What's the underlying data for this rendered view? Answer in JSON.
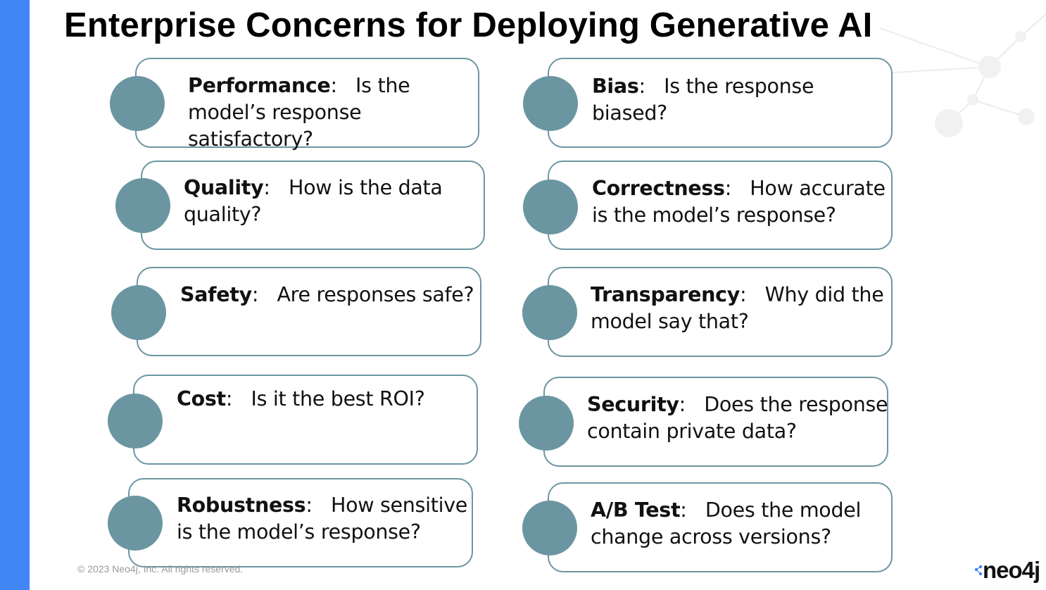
{
  "slide": {
    "title": "Enterprise Concerns for Deploying Generative AI",
    "footer": "© 2023 Neo4j, Inc. All rights reserved.",
    "logo_text": "neo4j",
    "accent_color": "#4285f4",
    "circle_color": "#6b96a1"
  },
  "concerns": [
    {
      "label": "Performance",
      "question": "Is the model’s response satisfactory?"
    },
    {
      "label": "Quality",
      "question": "How is the data quality?"
    },
    {
      "label": "Safety",
      "question": "Are responses safe?"
    },
    {
      "label": "Cost",
      "question": "Is it the best ROI?"
    },
    {
      "label": "Robustness",
      "question": "How sensitive is the model’s response?"
    },
    {
      "label": "Bias",
      "question": "Is the response biased?"
    },
    {
      "label": "Correctness",
      "question": "How accurate is the model’s response?"
    },
    {
      "label": "Transparency",
      "question": "Why did the model say that?"
    },
    {
      "label": "Security",
      "question": "Does the response contain private data?"
    },
    {
      "label": "A/B Test",
      "question": "Does the model change across versions?"
    }
  ]
}
